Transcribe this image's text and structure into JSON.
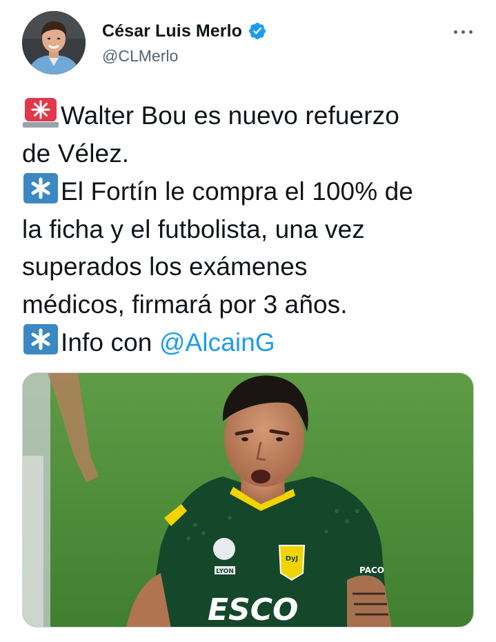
{
  "author": {
    "display_name": "César Luis Merlo",
    "handle": "@CLMerlo",
    "verified": true,
    "avatar_icon": "profile-photo"
  },
  "more_icon": "more-options-icon",
  "tweet": {
    "line1": "Walter Bou es nuevo refuerzo",
    "line2": "de Vélez.",
    "line3": "El Fortín le compra el 100% de",
    "line4": "la ficha y el futbolista, una vez",
    "line5": "superados los exámenes",
    "line6": "médicos, firmará por 3 años.",
    "line7_prefix": "Info con ",
    "mention": "@AlcainG",
    "emojis": [
      "rotating-light-emoji",
      "asterisk-emoji",
      "asterisk-emoji"
    ]
  },
  "media": {
    "description_icon": "football-player-photo",
    "jersey_texts": [
      "LYON",
      "PACO",
      "ESCO",
      "DyJ"
    ]
  },
  "colors": {
    "text": "#0f1419",
    "secondary": "#536471",
    "link": "#1d9bf0",
    "verified": "#1d9bf0"
  }
}
